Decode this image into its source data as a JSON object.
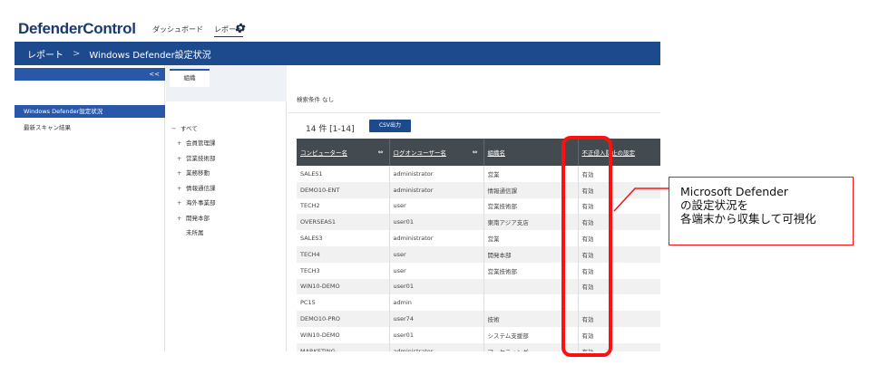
{
  "app": {
    "logo": "DefenderControl",
    "nav": [
      "ダッシュボード",
      "レポート"
    ],
    "gear_icon": "gear-icon"
  },
  "breadcrumb": {
    "items": [
      "レポート",
      "Windows Defender設定状況"
    ],
    "separator": ">"
  },
  "sidebar": {
    "collapse": "<<",
    "items": [
      {
        "label": "Windows Defender設定状況",
        "active": true
      },
      {
        "label": "最新スキャン結果",
        "active": false
      }
    ]
  },
  "org": {
    "tab": "組織",
    "tree": [
      {
        "label": "すべて",
        "mark": "−"
      },
      {
        "label": "会員管理課",
        "mark": "+"
      },
      {
        "label": "営業技術部",
        "mark": "+"
      },
      {
        "label": "業務移動",
        "mark": "+"
      },
      {
        "label": "情報通信課",
        "mark": "+"
      },
      {
        "label": "海外事業部",
        "mark": "+"
      },
      {
        "label": "開発本部",
        "mark": "+"
      },
      {
        "label": "未所属",
        "mark": ""
      }
    ]
  },
  "main": {
    "condition": "検索条件 なし",
    "count": "14 件 [1-14]",
    "csv_button": "CSV出力",
    "columns": [
      "コンピューター名",
      "ログオンユーザー名",
      "組織名",
      "不正侵入防止の設定"
    ],
    "rows": [
      [
        "SALES1",
        "administrator",
        "営業",
        "有効"
      ],
      [
        "DEMO10-ENT",
        "administrator",
        "情報通信課",
        "有効"
      ],
      [
        "TECH2",
        "user",
        "営業技術部",
        "有効"
      ],
      [
        "OVERSEAS1",
        "user01",
        "東南アジア支店",
        "有効"
      ],
      [
        "SALES3",
        "administrator",
        "営業",
        "有効"
      ],
      [
        "TECH4",
        "user",
        "開発本部",
        "有効"
      ],
      [
        "TECH3",
        "user",
        "営業技術部",
        "有効"
      ],
      [
        "WIN10-DEMO",
        "user01",
        "",
        "有効"
      ],
      [
        "PC15",
        "admin",
        "",
        ""
      ],
      [
        "DEMO10-PRO",
        "user74",
        "技術",
        "有効"
      ],
      [
        "WIN10-DEMO",
        "user01",
        "システム支援部",
        "有効"
      ],
      [
        "MARKETING",
        "administrator",
        "マーケティング",
        "有効"
      ]
    ]
  },
  "callout": {
    "lines": [
      "Microsoft Defender",
      "の設定状況を",
      "各端末から収集して可視化"
    ],
    "color": "#ff1010"
  }
}
